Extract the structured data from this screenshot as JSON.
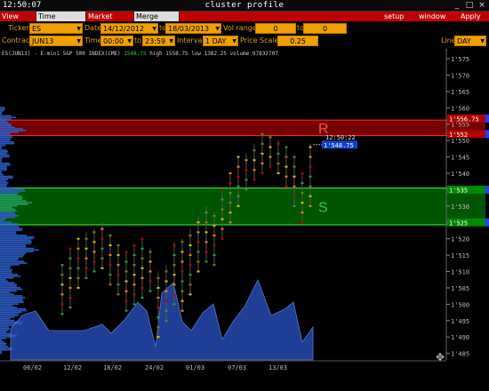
{
  "titlebar": {
    "clock": "12:50:07",
    "title": "cluster profile",
    "min_icon": "minimize-icon",
    "max_icon": "maximize-icon",
    "close_icon": "close-icon"
  },
  "menubar": {
    "tabs": [
      "View DOM",
      "Time Interval",
      "Market Watch",
      "Merge Contr"
    ],
    "active_tab": "Time Interval",
    "setup": "setup",
    "window": "window",
    "apply": "Apply"
  },
  "params": {
    "ticker_label": "Ticker",
    "ticker_value": "ES",
    "date_label": "Date",
    "date_from": "14/12/2012",
    "date_to_label": "to",
    "date_to": "18/03/2013",
    "vol_range_label": "Vol range",
    "vol_from": "0",
    "vol_to_label": "to",
    "vol_to": "0",
    "contract_label": "Contract",
    "contract_value": "JUN13",
    "time_label": "Time",
    "time_from": "00:00",
    "time_to_label": "to",
    "time_to": "23:59",
    "interval_label": "Interval",
    "interval_value": "1 DAY",
    "price_scale_label": "Price Scale",
    "price_scale_value": "0.25",
    "line_label": "Line",
    "line_value": "DAY"
  },
  "info": {
    "symbol": "ES(JUN13) - E-mini S&P 500 INDEX(CME)",
    "last": "1548.75",
    "high_label": "high",
    "high": "1558.75",
    "low_label": "low",
    "low": "1382.25",
    "volume_label": "volume",
    "volume": "97832707"
  },
  "chart_data": {
    "type": "cluster-profile",
    "y_ticks": [
      "1'575",
      "1'570",
      "1'565",
      "1'560",
      "1'555",
      "1'550",
      "1'545",
      "1'540",
      "1'535",
      "1'530",
      "1'525",
      "1'520",
      "1'515",
      "1'510",
      "1'505",
      "1'500",
      "1'495",
      "1'490",
      "1'485"
    ],
    "x_ticks": [
      "06/02",
      "12/02",
      "18/02",
      "24/02",
      "01/03",
      "07/03",
      "13/03"
    ],
    "ylim": [
      1483,
      1578
    ],
    "zones": [
      {
        "label": "R",
        "from": 1551.5,
        "to": 1556.25,
        "color": "#8b0000"
      },
      {
        "label": "S",
        "from": 1524.25,
        "to": 1535.5,
        "color": "#006400"
      }
    ],
    "price_markers": [
      {
        "text": "1'556.75",
        "price": 1556.75,
        "color": "#b00000"
      },
      {
        "text": "1'552",
        "price": 1552,
        "color": "#b00000"
      },
      {
        "text": "1'535",
        "price": 1535,
        "color": "#008800"
      },
      {
        "text": "1'525",
        "price": 1525,
        "color": "#008800"
      }
    ],
    "current_time": "12:50:22",
    "current_price": "1'548.75",
    "current_price_value": 1548.75
  }
}
